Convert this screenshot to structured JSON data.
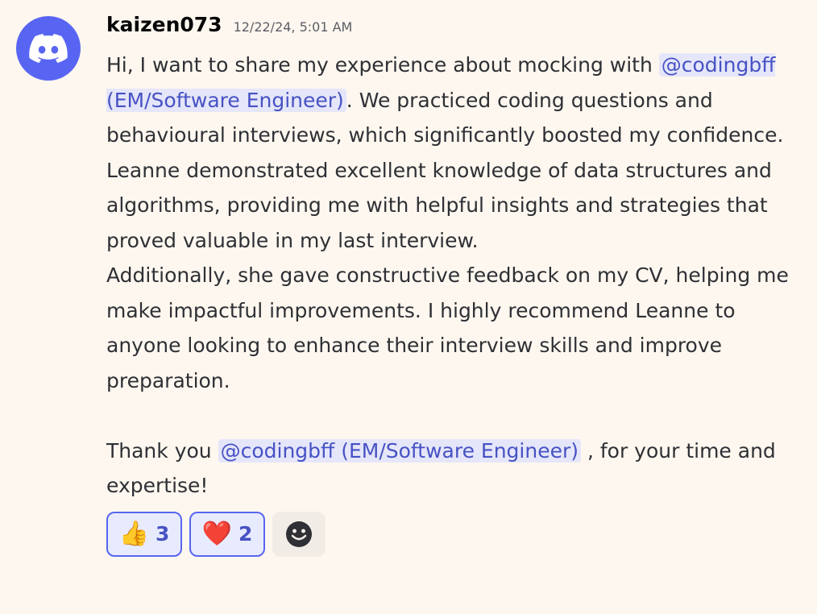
{
  "message": {
    "author": "kaizen073",
    "timestamp": "12/22/24, 5:01 AM",
    "line1": "Hi, I want to share my experience about mocking with",
    "mention1": "@codingbff (EM/Software Engineer)",
    "after_mention1": ". We practiced coding questions and behavioural interviews, which significantly boosted my confidence. Leanne demonstrated excellent knowledge of data structures and algorithms, providing me with helpful insights and strategies that proved valuable in my last interview.",
    "paragraph2": "Additionally, she gave constructive feedback on my CV, helping me make impactful improvements. I highly recommend Leanne to anyone looking to enhance their interview skills and improve preparation.",
    "thanks_prefix": "Thank you",
    "mention2": "@codingbff (EM/Software Engineer)",
    "thanks_suffix": ", for your time and expertise!"
  },
  "reactions": [
    {
      "emoji": "👍",
      "count": "3",
      "icon": "thumbs-up-icon"
    },
    {
      "emoji": "❤️",
      "count": "2",
      "icon": "heart-icon"
    }
  ],
  "colors": {
    "background": "#fdf7ef",
    "avatar": "#5865f2",
    "mention_bg": "#e5e6f9",
    "mention_text": "#4752c4"
  }
}
